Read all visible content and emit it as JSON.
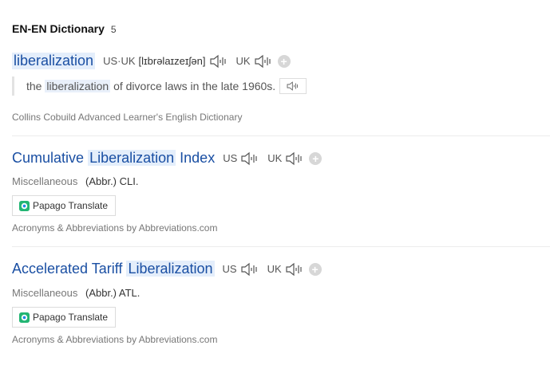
{
  "header": {
    "title": "EN-EN Dictionary",
    "count": "5"
  },
  "entry1": {
    "headword": "liberalization",
    "pron_label": "US·UK",
    "pron": "[lɪbrəlaɪzeɪʃən]",
    "uk_label": "UK",
    "example_before": "the",
    "example_hl": "liberalization",
    "example_after": "of divorce laws in the late 1960s.",
    "source": "Collins Cobuild Advanced Learner's English Dictionary"
  },
  "entry2": {
    "head_before": "Cumulative",
    "head_hl": "Liberalization",
    "head_after": "Index",
    "us_label": "US",
    "uk_label": "UK",
    "category": "Miscellaneous",
    "definition": "(Abbr.) CLI.",
    "papago_label": "Papago Translate",
    "source": "Acronyms & Abbreviations by Abbreviations.com"
  },
  "entry3": {
    "head_before": "Accelerated Tariff",
    "head_hl": "Liberalization",
    "head_after": "",
    "us_label": "US",
    "uk_label": "UK",
    "category": "Miscellaneous",
    "definition": "(Abbr.) ATL.",
    "papago_label": "Papago Translate",
    "source": "Acronyms & Abbreviations by Abbreviations.com"
  },
  "icons": {
    "speaker": "speaker-icon",
    "add": "plus-icon",
    "papago": "papago-logo-icon"
  },
  "colors": {
    "link": "#1a4fa3",
    "highlight": "#e4eefb",
    "muted": "#777777"
  }
}
